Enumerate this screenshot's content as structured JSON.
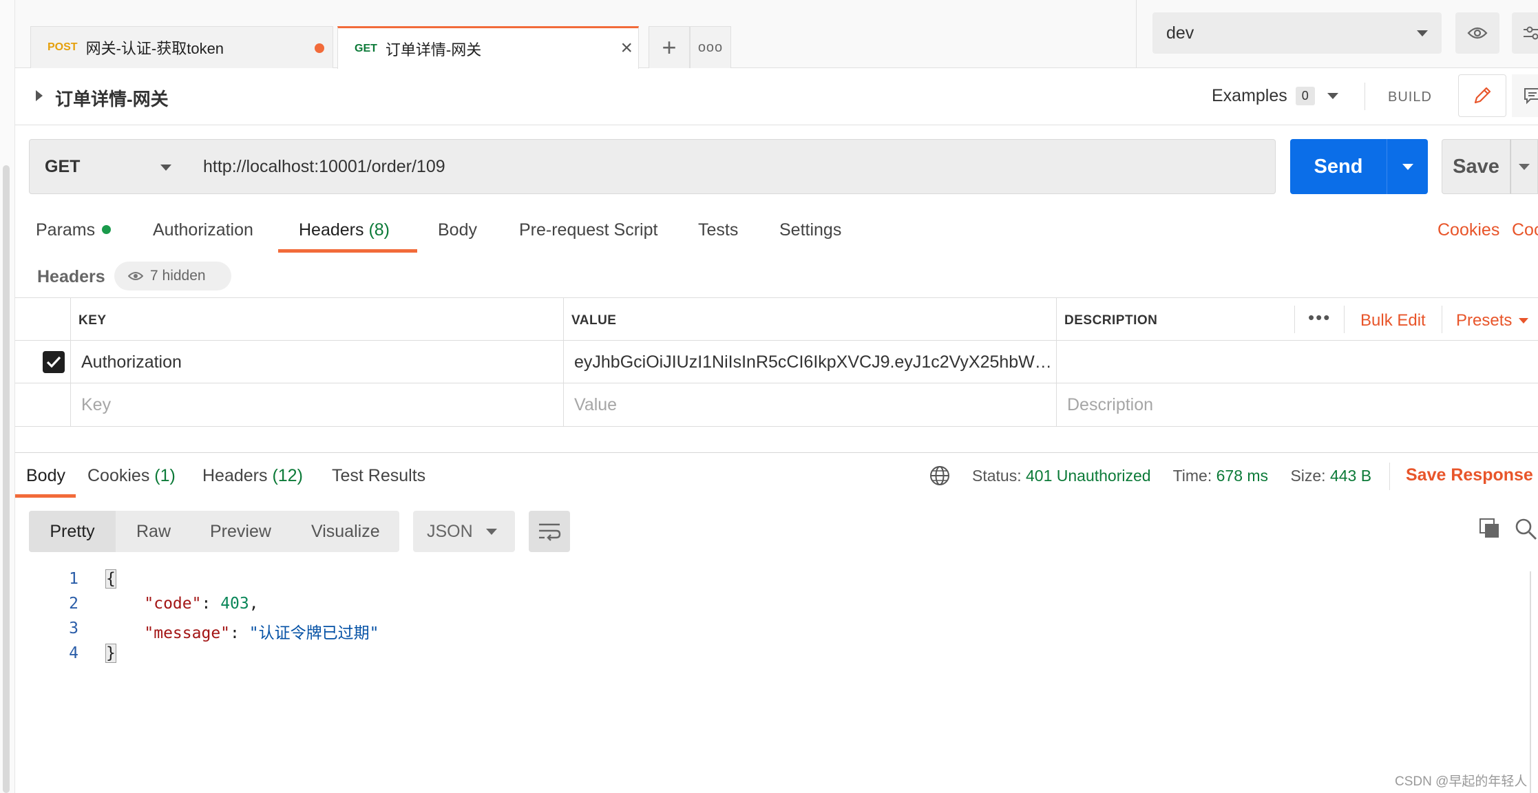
{
  "tabs": [
    {
      "method": "POST",
      "title": "网关-认证-获取token",
      "unsaved": true
    },
    {
      "method": "GET",
      "title": "订单详情-网关",
      "active": true
    }
  ],
  "environment": {
    "selected": "dev"
  },
  "request": {
    "title": "订单详情-网关",
    "examples_label": "Examples",
    "examples_count": "0",
    "build_label": "BUILD",
    "method": "GET",
    "url": "http://localhost:10001/order/109",
    "send_label": "Send",
    "save_label": "Save"
  },
  "request_tabs": {
    "params": "Params",
    "authorization": "Authorization",
    "headers": "Headers",
    "headers_count": "(8)",
    "body": "Body",
    "prerequest": "Pre-request Script",
    "tests": "Tests",
    "settings": "Settings",
    "cookies_link": "Cookies",
    "code_link": "Coc"
  },
  "headers_section": {
    "label": "Headers",
    "hidden": "7 hidden",
    "columns": {
      "key": "KEY",
      "value": "VALUE",
      "description": "DESCRIPTION"
    },
    "more": "•••",
    "bulk_edit": "Bulk Edit",
    "presets": "Presets",
    "rows": [
      {
        "enabled": true,
        "key": "Authorization",
        "value": "eyJhbGciOiJIUzI1NiIsInR5cCI6IkpXVCJ9.eyJ1c2VyX25hbWUiOiJ..."
      }
    ],
    "placeholder": {
      "key": "Key",
      "value": "Value",
      "description": "Description"
    }
  },
  "response": {
    "tabs": {
      "body": "Body",
      "cookies": "Cookies",
      "cookies_count": "(1)",
      "headers": "Headers",
      "headers_count": "(12)",
      "tests": "Test Results"
    },
    "status_label": "Status:",
    "status": "401 Unauthorized",
    "time_label": "Time:",
    "time": "678 ms",
    "size_label": "Size:",
    "size": "443 B",
    "save_response": "Save Response",
    "views": [
      "Pretty",
      "Raw",
      "Preview",
      "Visualize"
    ],
    "format": "JSON",
    "body_lines": [
      "1",
      "2",
      "3",
      "4"
    ],
    "json": {
      "code_key": "\"code\"",
      "code_value": "403",
      "message_key": "\"message\"",
      "message_value": "\"认证令牌已过期\""
    }
  },
  "colors": {
    "accent": "#f26b3a",
    "send": "#0b6ee8",
    "success": "#0c7a38",
    "link": "#e8552a"
  },
  "watermark": "CSDN @早起的年轻人"
}
